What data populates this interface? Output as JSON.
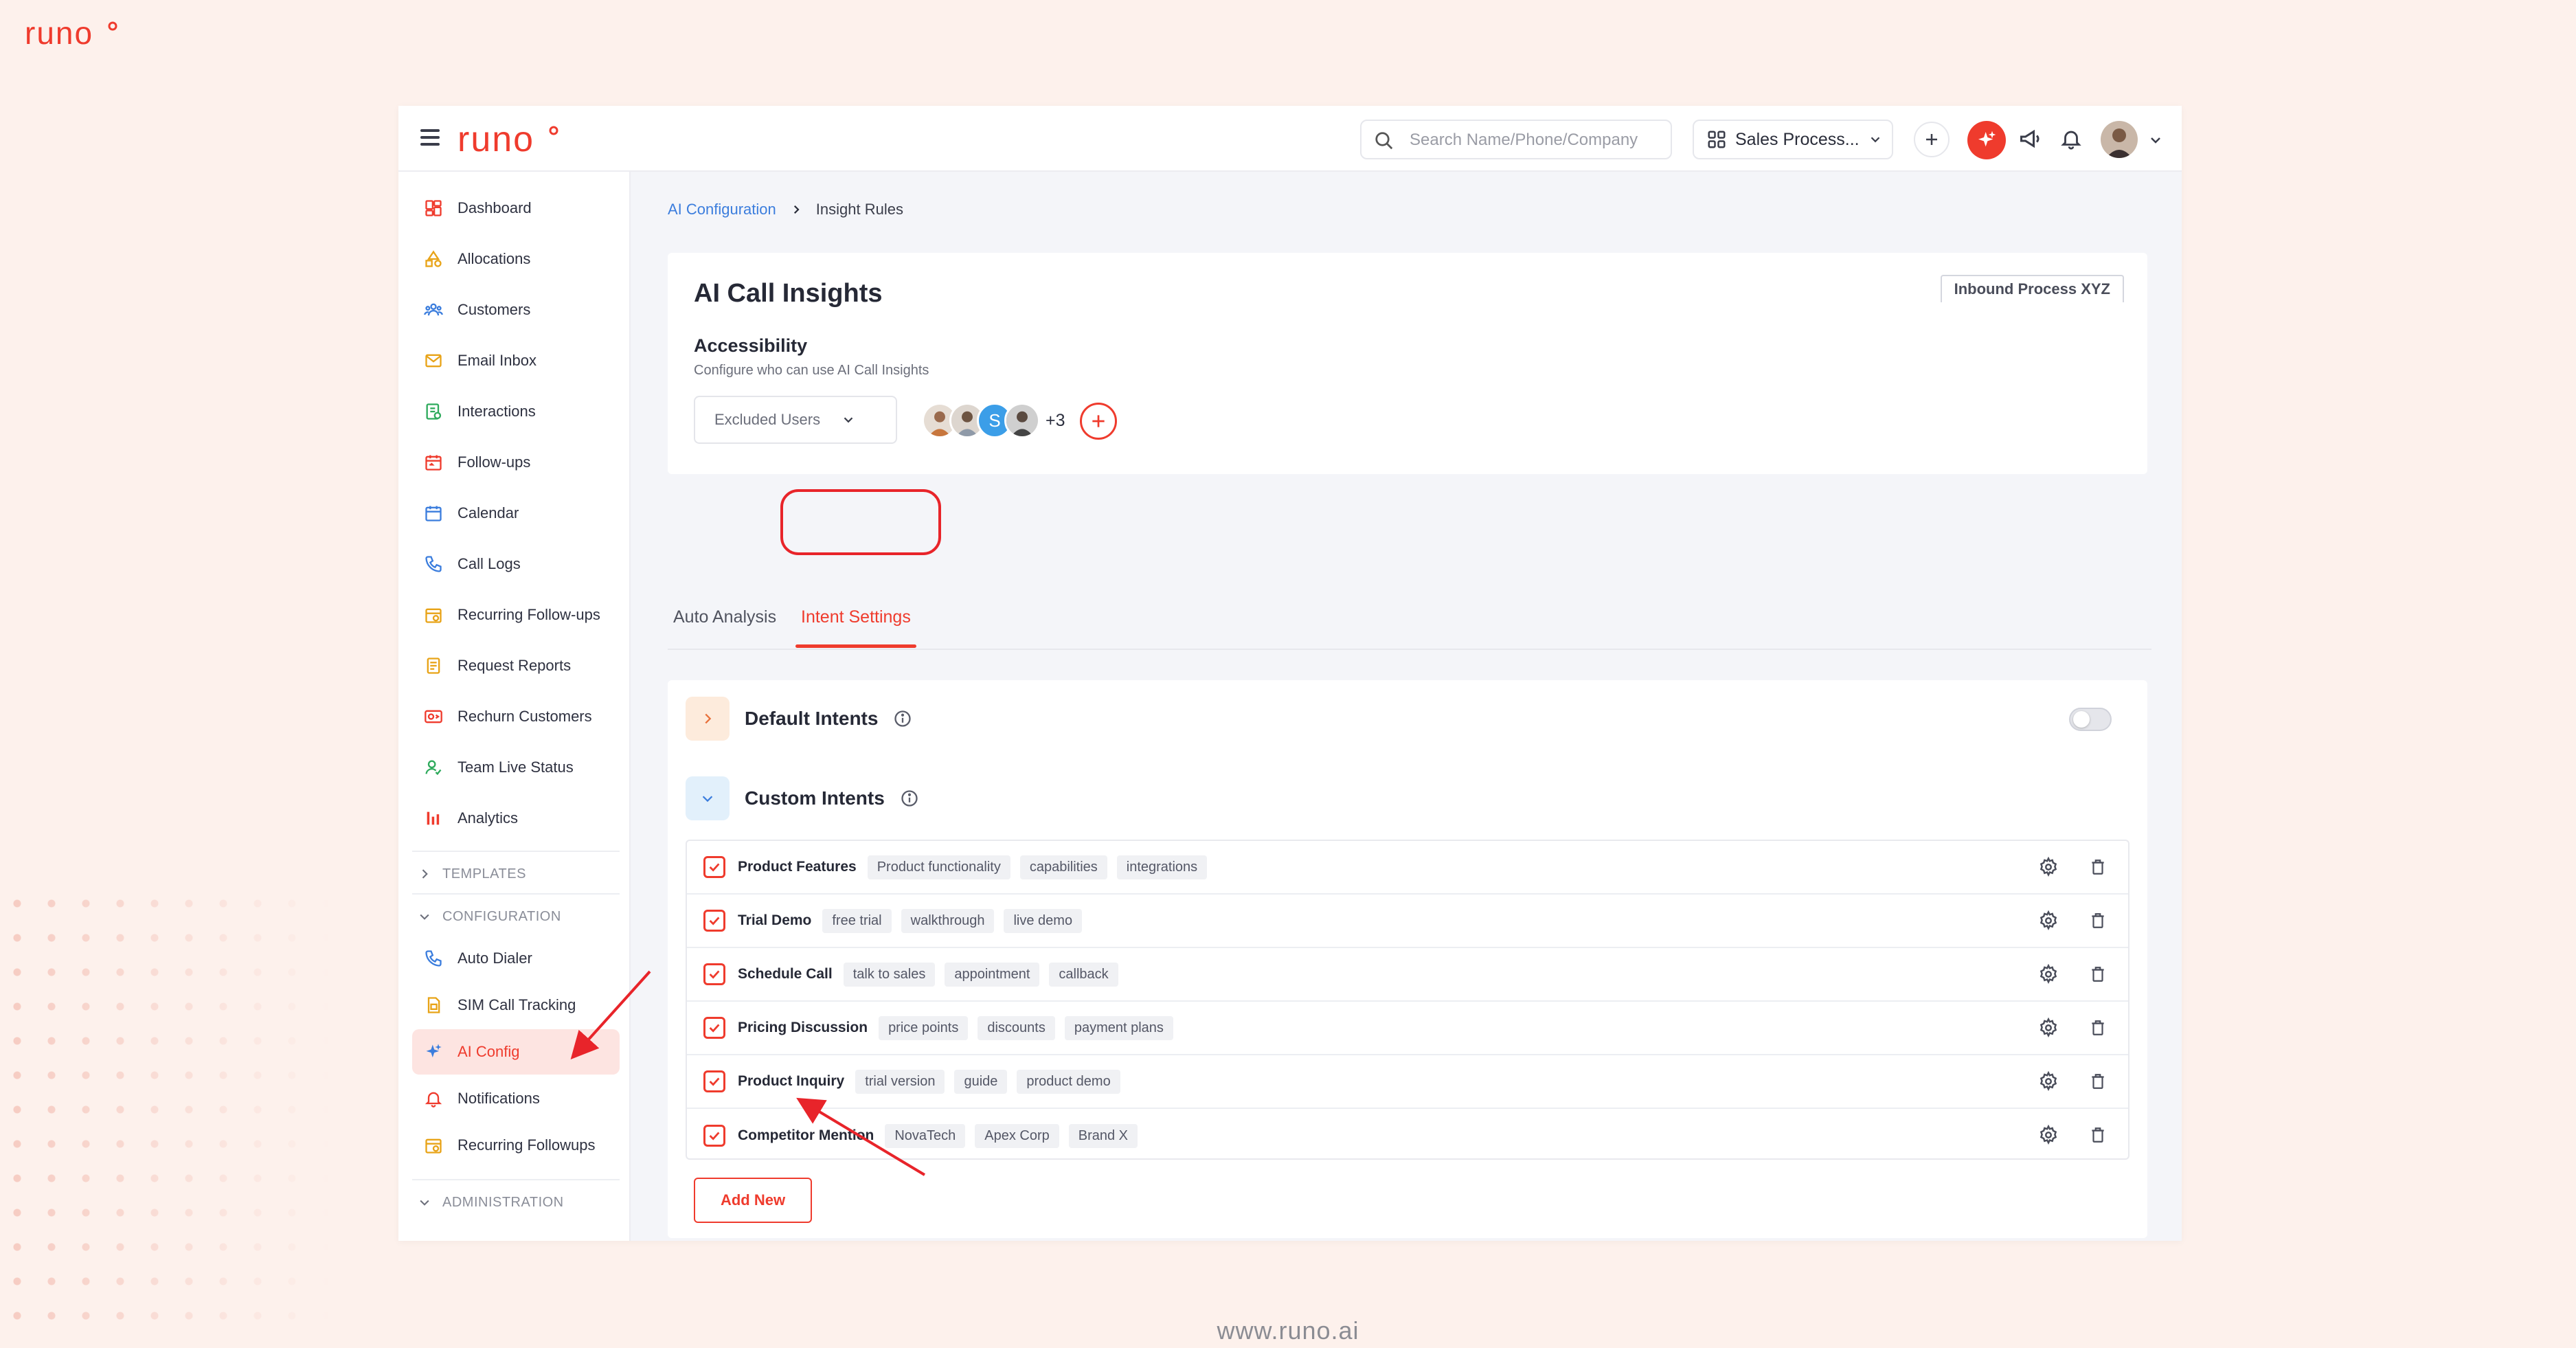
{
  "brand": {
    "name": "runo",
    "accent": "#ef3b2d",
    "footer_url": "www.runo.ai"
  },
  "topbar": {
    "search_placeholder": "Search Name/Phone/Company",
    "process_select": "Sales Process...",
    "icons": [
      "menu-icon",
      "search-icon",
      "grid-icon",
      "plus-icon",
      "ai-sparkle-icon",
      "megaphone-icon",
      "bell-icon",
      "avatar",
      "chevron-down-icon"
    ]
  },
  "sidebar": {
    "items": [
      {
        "label": "Dashboard",
        "icon": "dashboard-icon"
      },
      {
        "label": "Allocations",
        "icon": "allocations-icon"
      },
      {
        "label": "Customers",
        "icon": "customers-icon"
      },
      {
        "label": "Email Inbox",
        "icon": "mail-icon"
      },
      {
        "label": "Interactions",
        "icon": "interactions-icon"
      },
      {
        "label": "Follow-ups",
        "icon": "followups-icon"
      },
      {
        "label": "Calendar",
        "icon": "calendar-icon"
      },
      {
        "label": "Call Logs",
        "icon": "phone-icon"
      },
      {
        "label": "Recurring Follow-ups",
        "icon": "recurring-icon"
      },
      {
        "label": "Request Reports",
        "icon": "report-icon"
      },
      {
        "label": "Rechurn Customers",
        "icon": "rechurn-icon"
      },
      {
        "label": "Team Live Status",
        "icon": "team-status-icon"
      },
      {
        "label": "Analytics",
        "icon": "analytics-icon"
      }
    ],
    "templates_label": "TEMPLATES",
    "configuration_label": "CONFIGURATION",
    "config_items": [
      {
        "label": "Auto Dialer",
        "icon": "phone-icon"
      },
      {
        "label": "SIM Call Tracking",
        "icon": "sim-icon"
      },
      {
        "label": "AI Config",
        "icon": "ai-sparkle-icon",
        "active": true
      },
      {
        "label": "Notifications",
        "icon": "bell-icon"
      },
      {
        "label": "Recurring Followups",
        "icon": "recurring-icon"
      }
    ],
    "administration_label": "ADMINISTRATION"
  },
  "breadcrumb": {
    "parent": "AI Configuration",
    "current": "Insight Rules"
  },
  "insights_card": {
    "title": "AI Call Insights",
    "process_badge": "Inbound Process XYZ",
    "accessibility_title": "Accessibility",
    "accessibility_subtitle": "Configure who can use AI Call Insights",
    "excluded_select": "Excluded Users",
    "avatar_initial": "S",
    "more_count": "+3"
  },
  "tabs": [
    {
      "label": "Auto Analysis",
      "active": false
    },
    {
      "label": "Intent Settings",
      "active": true
    }
  ],
  "intents": {
    "default_label": "Default Intents",
    "default_enabled": false,
    "custom_label": "Custom Intents",
    "rows": [
      {
        "name": "Product Features",
        "tags": [
          "Product functionality",
          "capabilities",
          "integrations"
        ]
      },
      {
        "name": "Trial Demo",
        "tags": [
          "free trial",
          "walkthrough",
          "live demo"
        ]
      },
      {
        "name": "Schedule Call",
        "tags": [
          "talk to sales",
          "appointment",
          "callback"
        ]
      },
      {
        "name": "Pricing Discussion",
        "tags": [
          "price points",
          "discounts",
          "payment plans"
        ]
      },
      {
        "name": "Product Inquiry",
        "tags": [
          "trial version",
          "guide",
          "product demo"
        ]
      },
      {
        "name": "Competitor Mention",
        "tags": [
          "NovaTech",
          "Apex Corp",
          "Brand X"
        ]
      }
    ],
    "add_new_label": "Add New"
  }
}
